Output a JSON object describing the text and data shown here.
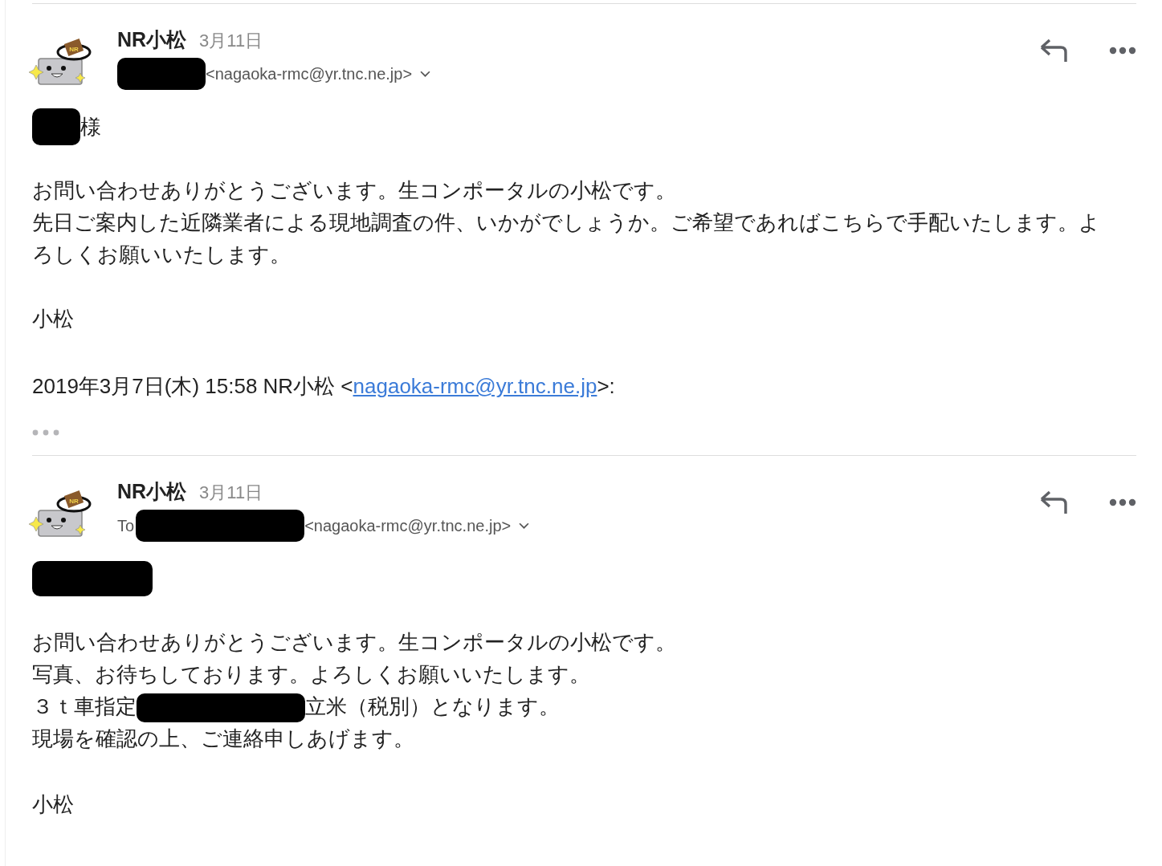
{
  "messages": [
    {
      "avatar_badge": "NR",
      "sender": "NR小松",
      "date": "3月11日",
      "recipient_redacted": true,
      "address": "<nagaoka-rmc@yr.tnc.ne.jp>",
      "greeting": [
        {
          "kind": "redacted_short"
        },
        {
          "kind": "text",
          "text": "様"
        }
      ],
      "body": [
        [
          {
            "kind": "text",
            "text": "お問い合わせありがとうございます。生コンポータルの小松です。"
          }
        ],
        [
          {
            "kind": "text",
            "text": "先日ご案内した近隣業者による現地調査の件、いかがでしょうか。ご希望であればこちらで手配いたします。よろしくお願いいたします。"
          }
        ]
      ],
      "signature": "小松",
      "quote": {
        "prefix": "2019年3月7日(木) 15:58 NR小松 <",
        "link": "nagaoka-rmc@yr.tnc.ne.jp",
        "suffix": ">:"
      },
      "collapsed_quote": true
    },
    {
      "avatar_badge": "NR",
      "sender": "NR小松",
      "date": "3月11日",
      "recipient_prefix": "To",
      "recipient_redacted": true,
      "address": "<nagaoka-rmc@yr.tnc.ne.jp>",
      "greeting": [
        {
          "kind": "redacted_long"
        }
      ],
      "body": [
        [
          {
            "kind": "text",
            "text": "お問い合わせありがとうございます。生コンポータルの小松です。"
          }
        ],
        [
          {
            "kind": "text",
            "text": "写真、お待ちしております。よろしくお願いいたします。"
          }
        ],
        [
          {
            "kind": "text",
            "text": "３ｔ車指定"
          },
          {
            "kind": "redacted_long"
          },
          {
            "kind": "text",
            "text": "立米（税別）となります。"
          }
        ],
        [
          {
            "kind": "text",
            "text": "現場を確認の上、ご連絡申しあげます。"
          }
        ]
      ],
      "signature": "小松"
    }
  ]
}
